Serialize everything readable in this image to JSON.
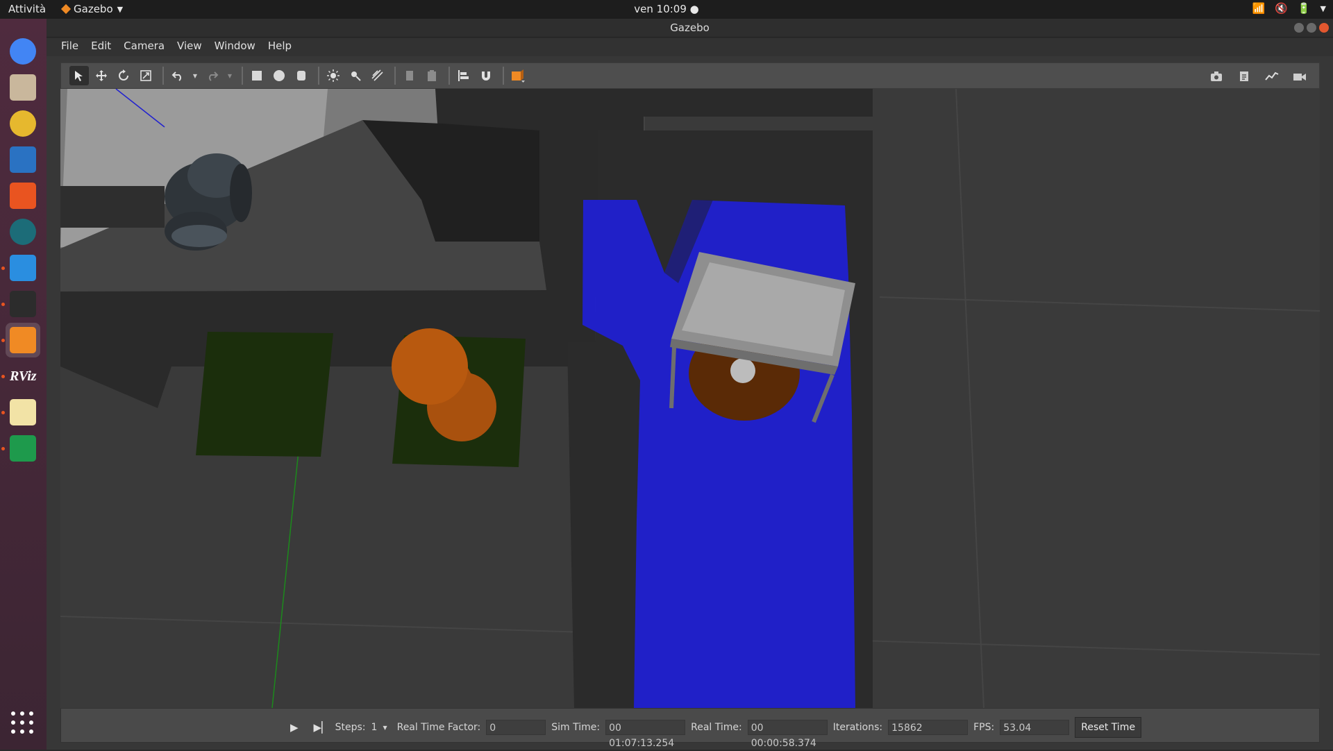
{
  "topbar": {
    "activities": "Attività",
    "app_name": "Gazebo",
    "clock": "ven 10:09 ●"
  },
  "window": {
    "title": "Gazebo"
  },
  "menu": {
    "items": [
      {
        "label": "File"
      },
      {
        "label": "Edit"
      },
      {
        "label": "Camera"
      },
      {
        "label": "View"
      },
      {
        "label": "Window"
      },
      {
        "label": "Help"
      }
    ]
  },
  "dock": {
    "items": [
      {
        "name": "chrome-icon",
        "color": "#4285f4",
        "running": false
      },
      {
        "name": "files-icon",
        "color": "#c9b79c",
        "running": false
      },
      {
        "name": "rhythmbox-icon",
        "color": "#e6b82e",
        "running": false
      },
      {
        "name": "writer-icon",
        "color": "#2a72c2",
        "running": false
      },
      {
        "name": "software-center-icon",
        "color": "#e95420",
        "running": false
      },
      {
        "name": "gitkraken-icon",
        "color": "#1c6c78",
        "running": false
      },
      {
        "name": "vscode-icon",
        "color": "#2a8ee0",
        "running": true
      },
      {
        "name": "terminal-icon",
        "color": "#2c2c2c",
        "running": true
      },
      {
        "name": "gazebo-icon",
        "color": "#f08a24",
        "running": true
      },
      {
        "name": "rviz-icon",
        "color": "#ffffff",
        "running": true
      },
      {
        "name": "text-editor-icon",
        "color": "#f2e3a6",
        "running": true
      },
      {
        "name": "calc-icon",
        "color": "#1e9a4c",
        "running": true
      }
    ],
    "rviz_text": "RViz"
  },
  "status": {
    "steps_label": "Steps:",
    "steps_value": "1",
    "rtf_label": "Real Time Factor:",
    "rtf_value": "0",
    "sim_time_label": "Sim Time:",
    "sim_time_value": "00 01:07:13.254",
    "real_time_label": "Real Time:",
    "real_time_value": "00 00:00:58.374",
    "iterations_label": "Iterations:",
    "iterations_value": "15862",
    "fps_label": "FPS:",
    "fps_value": "53.04",
    "reset_label": "Reset Time"
  },
  "colors": {
    "accent": "#e95420",
    "laser": "#1f1fd6",
    "pad": "#1b2e0c",
    "cylinder": "#a9510e"
  }
}
